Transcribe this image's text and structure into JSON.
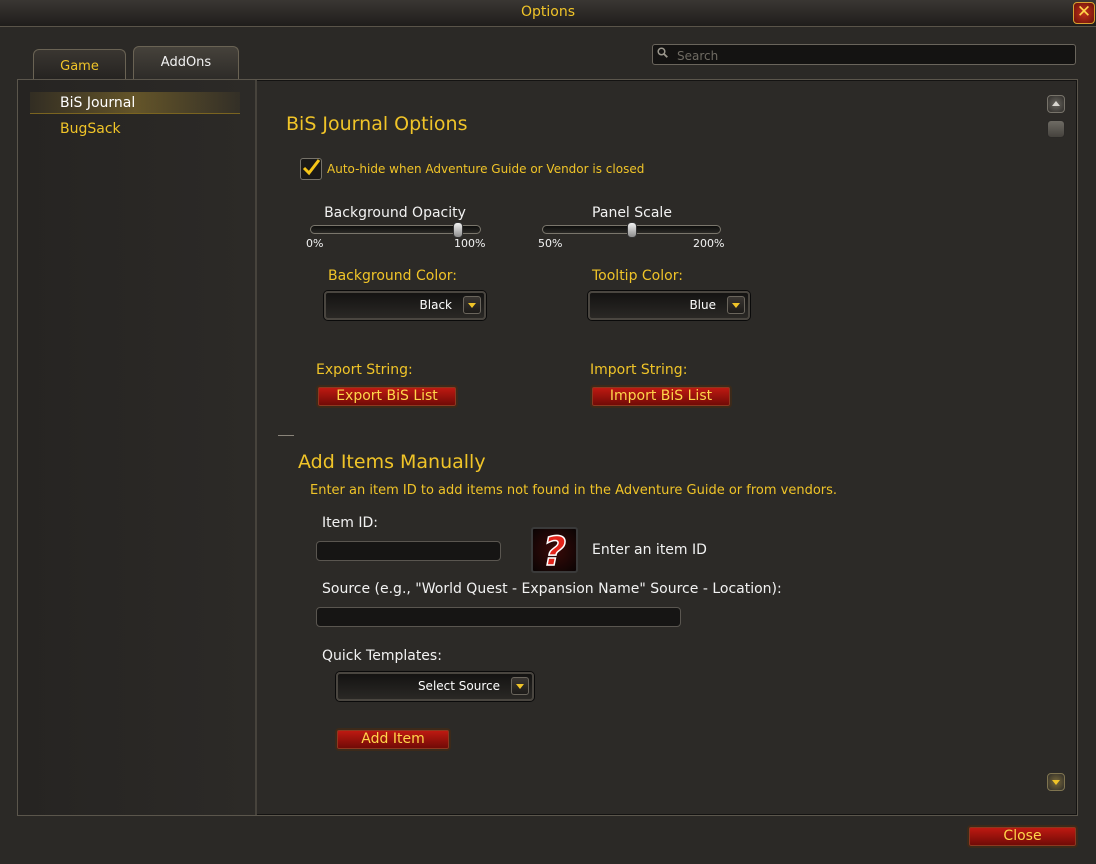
{
  "window": {
    "title": "Options",
    "close_icon": "close-x-icon"
  },
  "tabs": [
    {
      "label": "Game"
    },
    {
      "label": "AddOns"
    }
  ],
  "search": {
    "placeholder": "Search"
  },
  "sidebar": {
    "items": [
      {
        "label": "BiS Journal",
        "selected": true
      },
      {
        "label": "BugSack",
        "selected": false
      }
    ]
  },
  "panel": {
    "title": "BiS Journal Options",
    "autohide": {
      "label": "Auto-hide when Adventure Guide or Vendor is closed",
      "checked": true
    },
    "bg_opacity": {
      "label": "Background Opacity",
      "min_label": "0%",
      "max_label": "100%",
      "value_fraction": 0.9
    },
    "panel_scale": {
      "label": "Panel Scale",
      "min_label": "50%",
      "max_label": "200%",
      "value_fraction": 0.5
    },
    "bg_color": {
      "label": "Background Color:",
      "value": "Black"
    },
    "tooltip_color": {
      "label": "Tooltip Color:",
      "value": "Blue"
    },
    "export": {
      "label": "Export String:",
      "button": "Export BiS List"
    },
    "import": {
      "label": "Import String:",
      "button": "Import BiS List"
    }
  },
  "add_items": {
    "title": "Add Items Manually",
    "description": "Enter an item ID to add items not found in the Adventure Guide or from vendors.",
    "item_id_label": "Item ID:",
    "item_id_value": "",
    "item_preview_text": "Enter an item ID",
    "item_preview_icon": "question-mark-icon",
    "source_label": "Source (e.g., \"World Quest - Expansion Name\" Source - Location):",
    "source_value": "",
    "templates_label": "Quick Templates:",
    "templates_value": "Select Source",
    "add_button": "Add Item"
  },
  "footer": {
    "close_button": "Close"
  },
  "colors": {
    "gold": "#f0c428",
    "red_button": "#a8140e",
    "background": "#2b2926"
  }
}
